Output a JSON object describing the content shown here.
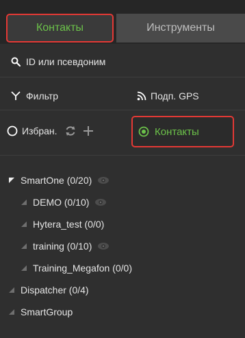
{
  "tabs": [
    {
      "label": "Контакты",
      "active": true
    },
    {
      "label": "Инструменты",
      "active": false
    }
  ],
  "search": {
    "placeholder": "ID или псевдоним"
  },
  "filter_row": {
    "filter_label": "Фильтр",
    "gps_label": "Подп. GPS"
  },
  "mode_row": {
    "favorites_label": "Избран.",
    "contacts_label": "Контакты",
    "contacts_selected": true
  },
  "tree": [
    {
      "label": "SmartOne (0/20)",
      "level": 0,
      "expanded": true,
      "eye": true
    },
    {
      "label": "DEMO (0/10)",
      "level": 1,
      "expanded": false,
      "eye": true
    },
    {
      "label": "Hytera_test (0/0)",
      "level": 1,
      "expanded": false,
      "eye": false
    },
    {
      "label": "training (0/10)",
      "level": 1,
      "expanded": false,
      "eye": true
    },
    {
      "label": "Training_Megafon (0/0)",
      "level": 1,
      "expanded": false,
      "eye": false
    },
    {
      "label": "Dispatcher (0/4)",
      "level": 0,
      "expanded": false,
      "eye": false
    },
    {
      "label": "SmartGroup",
      "level": 0,
      "expanded": false,
      "eye": false
    }
  ],
  "colors": {
    "accent_green": "#6cc24a",
    "highlight_red": "#e53935",
    "bg_dark": "#2f2f2f"
  }
}
